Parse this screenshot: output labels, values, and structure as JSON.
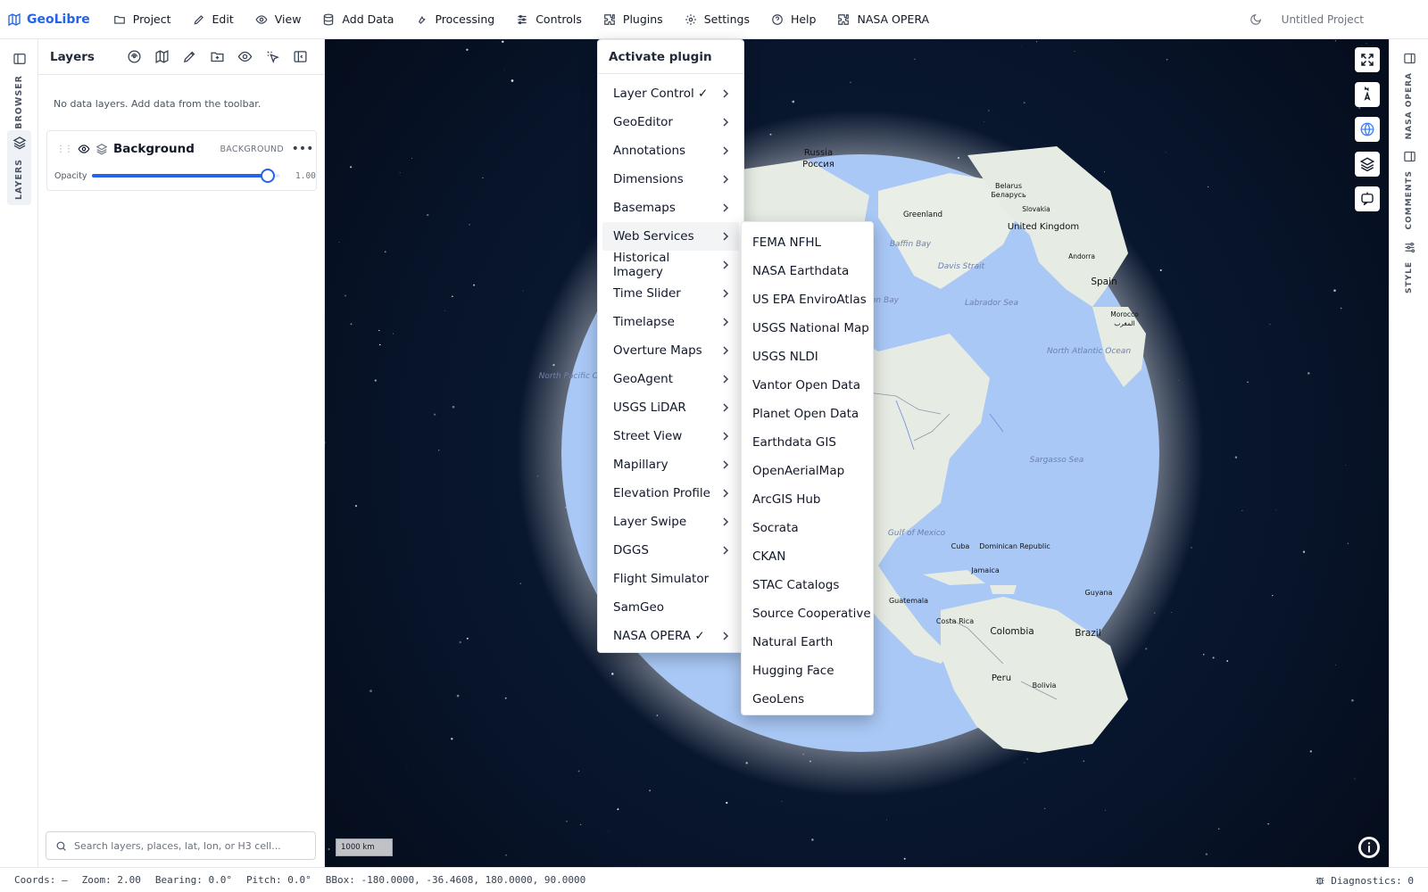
{
  "app": {
    "brand": "GeoLibre",
    "project_title": "Untitled Project"
  },
  "menubar": {
    "items": [
      {
        "label": "Project",
        "icon": "folder-icon"
      },
      {
        "label": "Edit",
        "icon": "pencil-icon"
      },
      {
        "label": "View",
        "icon": "eye-icon"
      },
      {
        "label": "Add Data",
        "icon": "database-icon"
      },
      {
        "label": "Processing",
        "icon": "wrench-icon"
      },
      {
        "label": "Controls",
        "icon": "sliders-icon"
      },
      {
        "label": "Plugins",
        "icon": "puzzle-icon"
      },
      {
        "label": "Settings",
        "icon": "gear-icon"
      },
      {
        "label": "Help",
        "icon": "help-circle-icon"
      },
      {
        "label": "NASA OPERA",
        "icon": "puzzle-icon"
      }
    ]
  },
  "left_rail": {
    "tabs": [
      {
        "label": "BROWSER",
        "icon": "panel-icon",
        "active": false
      },
      {
        "label": "LAYERS",
        "icon": "layers-icon",
        "active": true
      }
    ]
  },
  "layers_panel": {
    "title": "Layers",
    "empty_message": "No data layers. Add data from the toolbar.",
    "layer": {
      "name": "Background",
      "badge": "BACKGROUND",
      "opacity_label": "Opacity",
      "opacity_value": "1.00",
      "opacity": 1.0
    },
    "search_placeholder": "Search layers, places, lat, lon, or H3 cell..."
  },
  "plugins_menu": {
    "header": "Activate plugin",
    "items": [
      {
        "label": "Layer Control ✓",
        "submenu": true
      },
      {
        "label": "GeoEditor",
        "submenu": true
      },
      {
        "label": "Annotations",
        "submenu": true
      },
      {
        "label": "Dimensions",
        "submenu": true
      },
      {
        "label": "Basemaps",
        "submenu": true
      },
      {
        "label": "Web Services",
        "submenu": true,
        "active": true
      },
      {
        "label": "Historical Imagery",
        "submenu": true
      },
      {
        "label": "Time Slider",
        "submenu": true
      },
      {
        "label": "Timelapse",
        "submenu": true
      },
      {
        "label": "Overture Maps",
        "submenu": true
      },
      {
        "label": "GeoAgent",
        "submenu": true
      },
      {
        "label": "USGS LiDAR",
        "submenu": true
      },
      {
        "label": "Street View",
        "submenu": true
      },
      {
        "label": "Mapillary",
        "submenu": true
      },
      {
        "label": "Elevation Profile",
        "submenu": true
      },
      {
        "label": "Layer Swipe",
        "submenu": true
      },
      {
        "label": "DGGS",
        "submenu": true
      },
      {
        "label": "Flight Simulator",
        "submenu": false
      },
      {
        "label": "SamGeo",
        "submenu": false
      },
      {
        "label": "NASA OPERA ✓",
        "submenu": true
      }
    ]
  },
  "web_services_submenu": {
    "items": [
      "FEMA NFHL",
      "NASA Earthdata",
      "US EPA EnviroAtlas",
      "USGS National Map",
      "USGS NLDI",
      "Vantor Open Data",
      "Planet Open Data",
      "Earthdata GIS",
      "OpenAerialMap",
      "ArcGIS Hub",
      "Socrata",
      "CKAN",
      "STAC Catalogs",
      "Source Cooperative",
      "Natural Earth",
      "Hugging Face",
      "GeoLens"
    ]
  },
  "map": {
    "scale_label": "1000 km",
    "labels": [
      "Russia",
      "Россия",
      "Belarus",
      "Беларусь",
      "Slovakia",
      "Greenland",
      "United Kingdom",
      "Andorra",
      "Spain",
      "Morocco",
      "المغرب",
      "Baffin Bay",
      "Davis Strait",
      "Hudson Bay",
      "Labrador Sea",
      "North Atlantic Ocean",
      "North Pacific Ocean",
      "Sargasso Sea",
      "Gulf of Mexico",
      "Cuba",
      "Dominican Republic",
      "Jamaica",
      "Guatemala",
      "Costa Rica",
      "Guyana",
      "Colombia",
      "Brazil",
      "Peru",
      "Bolivia"
    ],
    "controls": [
      "fullscreen-icon",
      "compass-icon",
      "globe-icon",
      "layers-icon",
      "chat-bot-icon"
    ]
  },
  "right_rail": {
    "tabs": [
      {
        "label": "NASA OPERA",
        "icon": "panel-icon"
      },
      {
        "label": "COMMENTS",
        "icon": "panel-icon"
      },
      {
        "label": "STYLE",
        "icon": "sliders-icon"
      }
    ]
  },
  "statusbar": {
    "coords": "Coords: —",
    "zoom": "Zoom: 2.00",
    "bearing": "Bearing: 0.0°",
    "pitch": "Pitch: 0.0°",
    "bbox": "BBox: -180.0000, -36.4608, 180.0000, 90.0000",
    "diagnostics": "Diagnostics: 0"
  },
  "colors": {
    "accent": "#2563eb",
    "map_background": "#08152c",
    "ocean": "#a9c8f5",
    "land": "#e6ece3"
  }
}
